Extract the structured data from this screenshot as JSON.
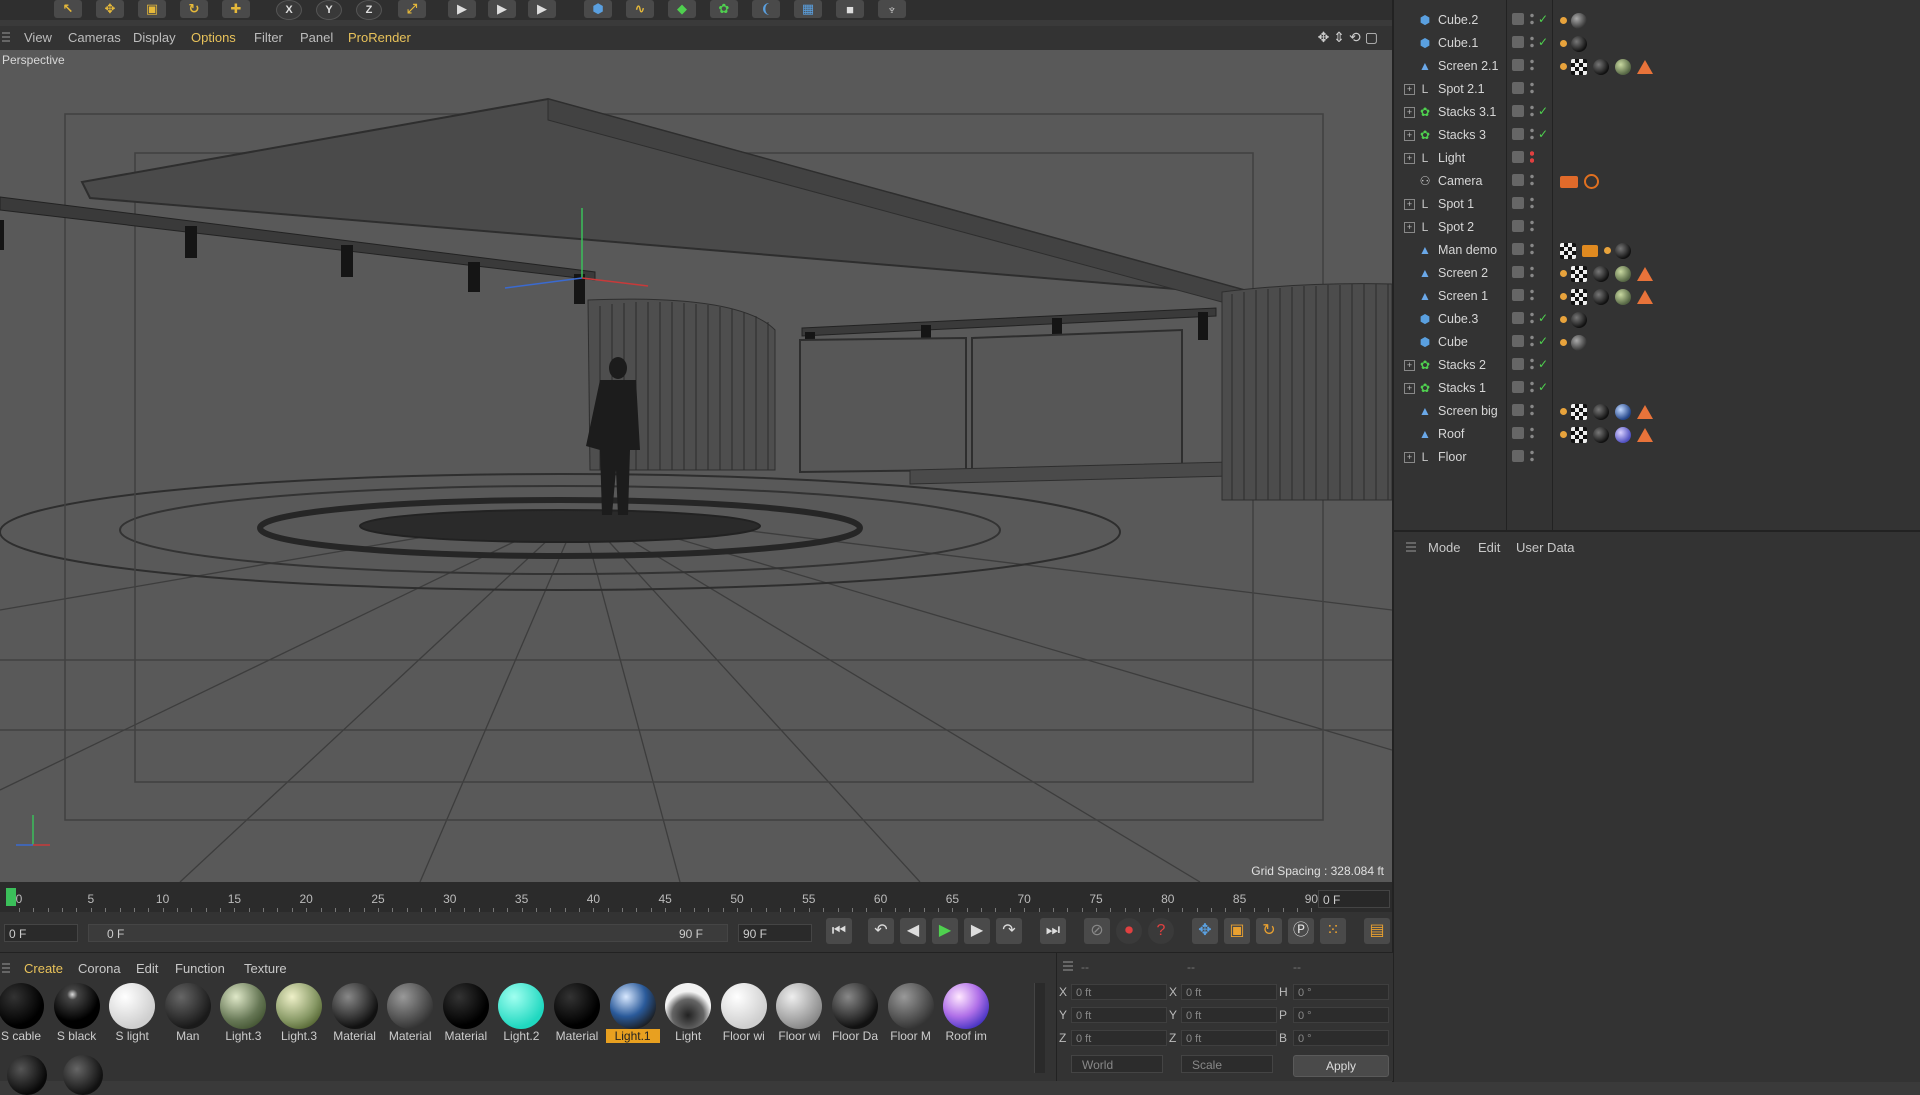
{
  "toolbar": {
    "axis_x": "X",
    "axis_y": "Y",
    "axis_z": "Z"
  },
  "viewport_menu": {
    "items": [
      "View",
      "Cameras",
      "Display",
      "Options",
      "Filter",
      "Panel",
      "ProRender"
    ],
    "active": "Options"
  },
  "viewport": {
    "label": "Perspective",
    "grid_spacing": "Grid Spacing : 328.084 ft"
  },
  "objects": [
    {
      "name": "Cube.2",
      "icon": "cube-icon",
      "expand": false
    },
    {
      "name": "Cube.1",
      "icon": "cube-icon",
      "expand": false
    },
    {
      "name": "Screen 2.1",
      "icon": "plane-icon",
      "expand": false
    },
    {
      "name": "Spot 2.1",
      "icon": "light-icon",
      "expand": true
    },
    {
      "name": "Stacks 3.1",
      "icon": "cloner-icon",
      "expand": true
    },
    {
      "name": "Stacks 3",
      "icon": "cloner-icon",
      "expand": true
    },
    {
      "name": "Light",
      "icon": "light-icon",
      "expand": true
    },
    {
      "name": "Camera",
      "icon": "camera-icon",
      "expand": false
    },
    {
      "name": "Spot 1",
      "icon": "light-icon",
      "expand": true
    },
    {
      "name": "Spot 2",
      "icon": "light-icon",
      "expand": true
    },
    {
      "name": "Man demo",
      "icon": "plane-icon",
      "expand": false
    },
    {
      "name": "Screen 2",
      "icon": "plane-icon",
      "expand": false
    },
    {
      "name": "Screen 1",
      "icon": "plane-icon",
      "expand": false
    },
    {
      "name": "Cube.3",
      "icon": "cube-icon",
      "expand": false
    },
    {
      "name": "Cube",
      "icon": "cube-icon",
      "expand": false
    },
    {
      "name": "Stacks 2",
      "icon": "cloner-icon",
      "expand": true
    },
    {
      "name": "Stacks 1",
      "icon": "cloner-icon",
      "expand": true
    },
    {
      "name": "Screen big",
      "icon": "plane-icon",
      "expand": false
    },
    {
      "name": "Roof",
      "icon": "plane-icon",
      "expand": false
    },
    {
      "name": "Floor",
      "icon": "light-icon",
      "expand": true
    }
  ],
  "attributes_menu": [
    "Mode",
    "Edit",
    "User Data"
  ],
  "timeline": {
    "ticks": [
      "0",
      "5",
      "10",
      "15",
      "20",
      "25",
      "30",
      "35",
      "40",
      "45",
      "50",
      "55",
      "60",
      "65",
      "70",
      "75",
      "80",
      "85",
      "90"
    ],
    "current_frame": "0 F"
  },
  "transport": {
    "start_field": "0 F",
    "range_start": "0 F",
    "range_end": "90 F",
    "end_field": "90 F"
  },
  "materials_menu": [
    "Create",
    "Corona",
    "Edit",
    "Function",
    "Texture"
  ],
  "materials_active": "Create",
  "materials": [
    {
      "label": "S cable",
      "style": "black"
    },
    {
      "label": "S black",
      "style": "blackgloss"
    },
    {
      "label": "S light",
      "style": "white"
    },
    {
      "label": "Man",
      "style": "darkgrey"
    },
    {
      "label": "Light.3",
      "style": "foliage"
    },
    {
      "label": "Light.3",
      "style": "foliage2"
    },
    {
      "label": "Material",
      "style": "dark"
    },
    {
      "label": "Material",
      "style": "grey"
    },
    {
      "label": "Material",
      "style": "black"
    },
    {
      "label": "Light.2",
      "style": "cyan"
    },
    {
      "label": "Material",
      "style": "black"
    },
    {
      "label": "Light.1",
      "style": "blueenv",
      "selected": true
    },
    {
      "label": "Light",
      "style": "chrome"
    },
    {
      "label": "Floor wi",
      "style": "white"
    },
    {
      "label": "Floor wi",
      "style": "lightgrey"
    },
    {
      "label": "Floor Da",
      "style": "dark"
    },
    {
      "label": "Floor M",
      "style": "grey"
    },
    {
      "label": "Roof im",
      "style": "purple"
    }
  ],
  "coords": {
    "header": [
      "--",
      "--",
      "--"
    ],
    "pos": [
      {
        "axis": "X",
        "value": "0 ft"
      },
      {
        "axis": "Y",
        "value": "0 ft"
      },
      {
        "axis": "Z",
        "value": "0 ft"
      }
    ],
    "size": [
      {
        "axis": "X",
        "value": "0 ft"
      },
      {
        "axis": "Y",
        "value": "0 ft"
      },
      {
        "axis": "Z",
        "value": "0 ft"
      }
    ],
    "rot": [
      {
        "axis": "H",
        "value": "0 °"
      },
      {
        "axis": "P",
        "value": "0 °"
      },
      {
        "axis": "B",
        "value": "0 °"
      }
    ],
    "mode_left": "World",
    "mode_right": "Scale",
    "apply": "Apply"
  },
  "colors": {
    "accent": "#e8c25a",
    "selected_material": "#e8a020",
    "play": "#4fd04f",
    "record": "#e04040"
  }
}
